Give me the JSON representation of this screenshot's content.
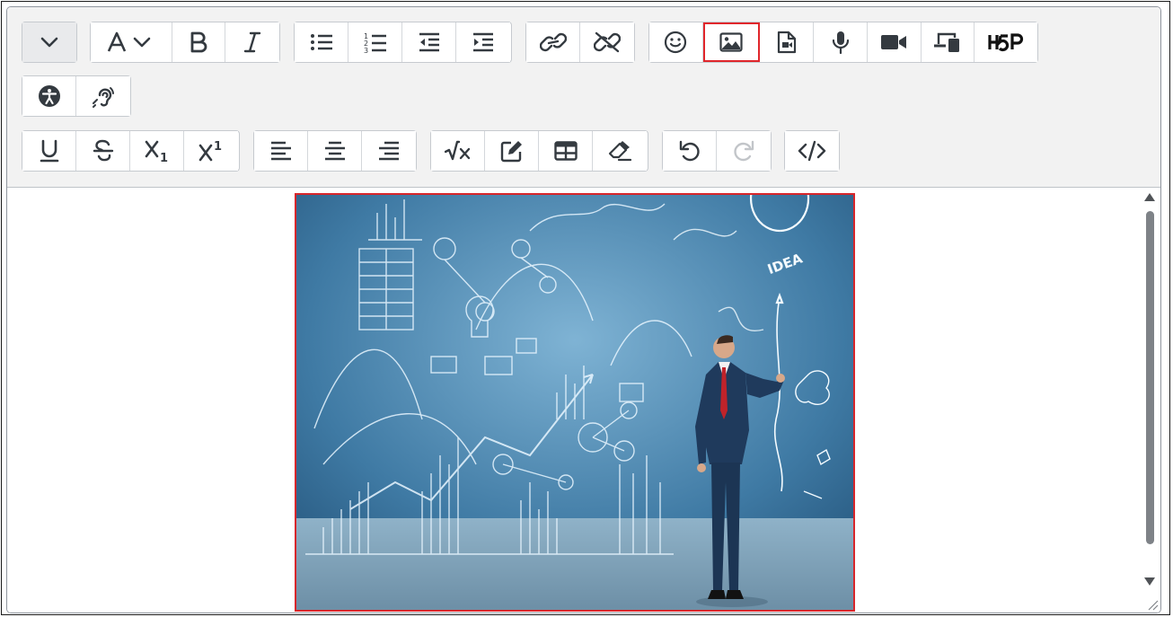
{
  "toolbar": {
    "row1": [
      {
        "name": "collapse-toolbar-button",
        "icon": "chevron-down-icon"
      },
      {
        "name": "paragraph-style-button",
        "icon": "font-a-icon"
      },
      {
        "name": "bold-button",
        "icon": "bold-icon"
      },
      {
        "name": "italic-button",
        "icon": "italic-icon"
      },
      {
        "name": "bullet-list-button",
        "icon": "unordered-list-icon"
      },
      {
        "name": "numbered-list-button",
        "icon": "ordered-list-icon"
      },
      {
        "name": "outdent-button",
        "icon": "outdent-icon"
      },
      {
        "name": "indent-button",
        "icon": "indent-icon"
      },
      {
        "name": "link-button",
        "icon": "link-icon"
      },
      {
        "name": "unlink-button",
        "icon": "unlink-icon"
      },
      {
        "name": "emoji-button",
        "icon": "smiley-icon"
      },
      {
        "name": "insert-image-button",
        "icon": "image-icon",
        "highlighted": true
      },
      {
        "name": "insert-media-button",
        "icon": "media-file-icon"
      },
      {
        "name": "record-audio-button",
        "icon": "microphone-icon"
      },
      {
        "name": "record-video-button",
        "icon": "video-camera-icon"
      },
      {
        "name": "manage-files-button",
        "icon": "devices-icon"
      },
      {
        "name": "h5p-button",
        "icon": "h5p-logo-icon"
      }
    ],
    "row2": [
      {
        "name": "accessibility-checker-button",
        "icon": "accessibility-icon"
      },
      {
        "name": "screen-reader-helper-button",
        "icon": "hearing-icon"
      }
    ],
    "row3": [
      {
        "name": "underline-button",
        "icon": "underline-icon"
      },
      {
        "name": "strikethrough-button",
        "icon": "strikethrough-icon"
      },
      {
        "name": "subscript-button",
        "icon": "subscript-icon"
      },
      {
        "name": "superscript-button",
        "icon": "superscript-icon"
      },
      {
        "name": "align-left-button",
        "icon": "align-left-icon"
      },
      {
        "name": "align-center-button",
        "icon": "align-center-icon"
      },
      {
        "name": "align-right-button",
        "icon": "align-right-icon"
      },
      {
        "name": "equation-editor-button",
        "icon": "square-root-icon"
      },
      {
        "name": "insert-character-button",
        "icon": "pencil-square-icon"
      },
      {
        "name": "insert-table-button",
        "icon": "table-icon"
      },
      {
        "name": "clear-formatting-button",
        "icon": "eraser-icon"
      },
      {
        "name": "undo-button",
        "icon": "undo-icon"
      },
      {
        "name": "redo-button",
        "icon": "redo-icon",
        "disabled": true
      },
      {
        "name": "html-source-button",
        "icon": "code-icon"
      }
    ]
  },
  "editor": {
    "image": {
      "description_icon": "photo-icon",
      "headline": "IDEA"
    }
  },
  "colors": {
    "icon": "#343a40",
    "highlight": "#e0262b",
    "toolbar_bg": "#f2f2f2"
  }
}
